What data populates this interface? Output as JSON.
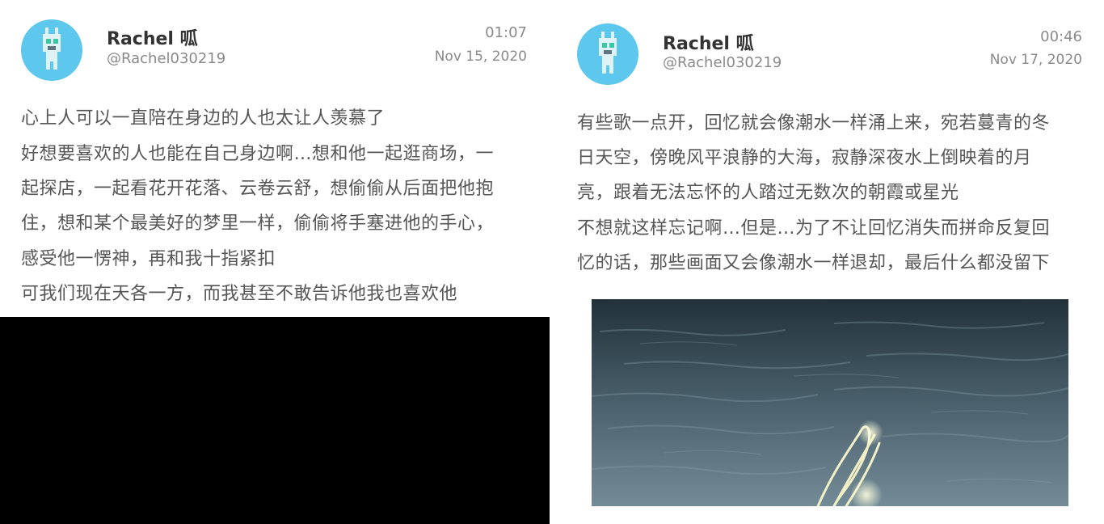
{
  "posts": [
    {
      "author": "Rachel 呱",
      "handle": "@Rachel030219",
      "time": "01:07",
      "date": "Nov 15, 2020",
      "lines": [
        "心上人可以一直陪在身边的人也太让人羡慕了",
        "好想要喜欢的人也能在自己身边啊…想和他一起逛商场，一",
        "起探店，一起看花开花落、云卷云舒，想偷偷从后面把他抱",
        "住，想和某个最美好的梦里一样，偷偷将手塞进他的手心，",
        "感受他一愣神，再和我十指紧扣",
        "可我们现在天各一方，而我甚至不敢告诉他我也喜欢他"
      ]
    },
    {
      "author": "Rachel 呱",
      "handle": "@Rachel030219",
      "time": "00:46",
      "date": "Nov 17, 2020",
      "lines": [
        "有些歌一点开，回忆就会像潮水一样涌上来，宛若蔓青的冬",
        "日天空，傍晚风平浪静的大海，寂静深夜水上倒映着的月",
        "亮，跟着无法忘怀的人踏过无数次的朝霞或星光",
        "不想就这样忘记啊…但是…为了不让回忆消失而拼命反复回",
        "忆的话，那些画面又会像潮水一样退却，最后什么都没留下"
      ]
    }
  ],
  "colors": {
    "avatar_bg": "#5ec7ee",
    "avatar_figure": "#dff3f6",
    "avatar_accent": "#37c8a4",
    "water_dark": "#26343c",
    "water_light": "#6c8592",
    "light_streak": "#f2f0c8"
  }
}
